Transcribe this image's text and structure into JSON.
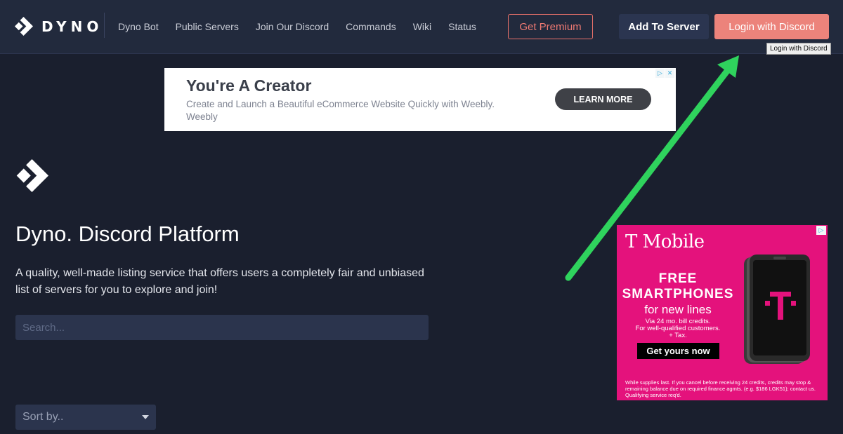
{
  "brand": {
    "name": "DYNO"
  },
  "nav": {
    "links": [
      "Dyno Bot",
      "Public Servers",
      "Join Our Discord",
      "Commands",
      "Wiki",
      "Status"
    ],
    "premium_label": "Get Premium",
    "add_label": "Add To Server",
    "login_label": "Login with Discord",
    "login_tooltip": "Login with Discord"
  },
  "banner_ad": {
    "title": "You're A Creator",
    "description": "Create and Launch a Beautiful eCommerce Website Quickly with Weebly. Weebly",
    "cta": "LEARN MORE",
    "choices": [
      "▷",
      "✕"
    ]
  },
  "hero": {
    "title": "Dyno. Discord Platform",
    "description": "A quality, well-made listing service that offers users a completely fair and unbiased list of servers for you to explore and join!",
    "search_placeholder": "Search...",
    "sort_label": "Sort by.."
  },
  "side_ad": {
    "brand": "T Mobile",
    "headline_1": "FREE",
    "headline_2": "SMARTPHONES",
    "subline": "for new lines",
    "fine_1": "Via 24 mo. bill credits.",
    "fine_2": "For well-qualified customers.",
    "fine_3": "+ Tax.",
    "cta": "Get yours now",
    "legal": "While supplies last. If you cancel before receiving 24 credits, credits may stop & remaining balance due on required finance agmts. (e.g. $186 LGK51); contact us. Qualifying service req'd.",
    "choice": "▷"
  },
  "colors": {
    "background": "#1a1f2e",
    "navbar": "#222a3d",
    "accent": "#ec837b",
    "arrow": "#2fd35d",
    "tmobile": "#e4127c"
  }
}
